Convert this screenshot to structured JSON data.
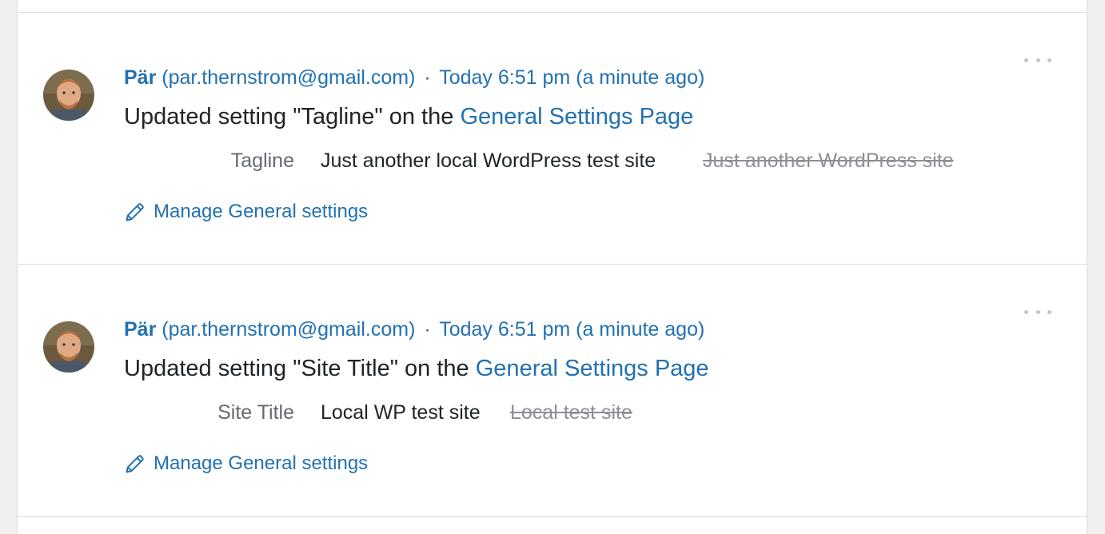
{
  "entries": [
    {
      "user": "Pär",
      "email": "(par.thernstrom@gmail.com)",
      "separator": "·",
      "time": "Today 6:51 pm (a minute ago)",
      "message_prefix": "Updated setting \"Tagline\" on the ",
      "message_link": "General Settings Page",
      "diff_label": "Tagline",
      "diff_new": "Just another local WordPress test site",
      "diff_old": "Just another WordPress site",
      "manage_label": "Manage General settings"
    },
    {
      "user": "Pär",
      "email": "(par.thernstrom@gmail.com)",
      "separator": "·",
      "time": "Today 6:51 pm (a minute ago)",
      "message_prefix": "Updated setting \"Site Title\" on the ",
      "message_link": "General Settings Page",
      "diff_label": "Site Title",
      "diff_new": "Local WP test site",
      "diff_old": "Local test site",
      "manage_label": "Manage General settings"
    }
  ],
  "colors": {
    "link": "#2271b1",
    "text": "#1d2327",
    "muted": "#646970",
    "strike": "#8c8f94",
    "divider": "#dcdcde",
    "background": "#f0f0f1"
  },
  "icons": {
    "avatar": "user-avatar",
    "menu": "more-options-icon",
    "edit": "pencil-icon"
  }
}
